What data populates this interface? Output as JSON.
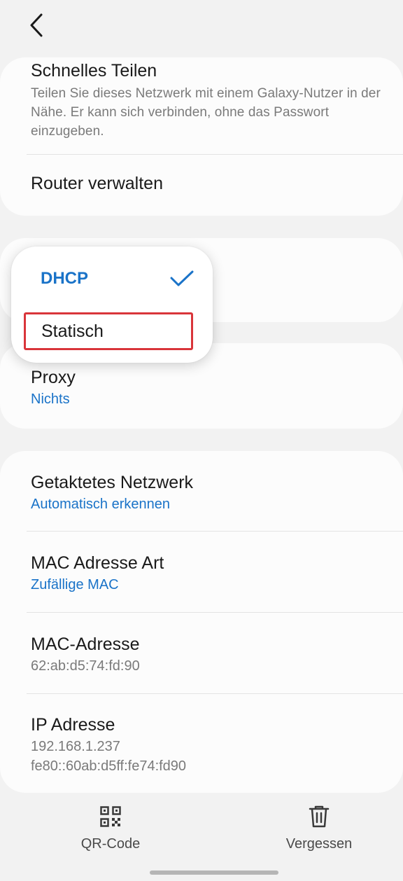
{
  "header": {
    "back_icon": "chevron-left-icon"
  },
  "quick_share": {
    "title": "Schnelles Teilen",
    "description": "Teilen Sie dieses Netzwerk mit einem Galaxy-Nutzer in der Nähe. Er kann sich verbinden, ohne das Passwort einzugeben."
  },
  "router": {
    "title": "Router verwalten"
  },
  "ip_settings_dropdown": {
    "options": [
      {
        "label": "DHCP",
        "selected": true
      },
      {
        "label": "Statisch",
        "selected": false
      }
    ],
    "highlight_color": "#d9353a"
  },
  "proxy": {
    "title": "Proxy",
    "value": "Nichts"
  },
  "metered": {
    "title": "Getaktetes Netzwerk",
    "value": "Automatisch erkennen"
  },
  "mac_type": {
    "title": "MAC Adresse Art",
    "value": "Zufällige MAC"
  },
  "mac_address": {
    "title": "MAC-Adresse",
    "value": "62:ab:d5:74:fd:90"
  },
  "ip_address": {
    "title": "IP Adresse",
    "ipv4": "192.168.1.237",
    "ipv6": "fe80::60ab:d5ff:fe74:fd90"
  },
  "bottom_bar": {
    "qr_label": "QR-Code",
    "qr_icon": "qr-code-icon",
    "forget_label": "Vergessen",
    "forget_icon": "trash-icon"
  },
  "colors": {
    "accent": "#1a73c8",
    "background": "#f2f2f2",
    "card": "#fcfcfc"
  }
}
